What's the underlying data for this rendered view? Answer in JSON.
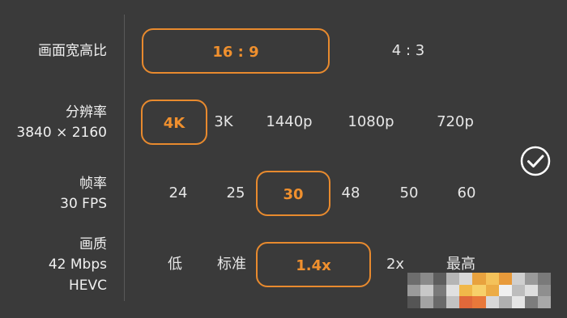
{
  "aspect_ratio": {
    "label": "画面宽高比",
    "options": [
      "16 : 9",
      "4 : 3"
    ],
    "selected": "16 : 9"
  },
  "resolution": {
    "label": "分辨率",
    "sublabel": "3840 × 2160",
    "options": [
      "4K",
      "3K",
      "1440p",
      "1080p",
      "720p"
    ],
    "selected": "4K"
  },
  "frame_rate": {
    "label": "帧率",
    "sublabel": "30 FPS",
    "options": [
      "24",
      "25",
      "30",
      "48",
      "50",
      "60"
    ],
    "selected": "30"
  },
  "quality": {
    "label": "画质",
    "sublabel": "42 Mbps",
    "sublabel2": "HEVC",
    "options": [
      "低",
      "标准",
      "1.4x",
      "2x",
      "最高"
    ],
    "selected": "1.4x"
  },
  "colors": {
    "accent": "#e88a2e",
    "background": "#3a3a3a"
  },
  "icons": {
    "confirm": "check-circle-icon"
  }
}
